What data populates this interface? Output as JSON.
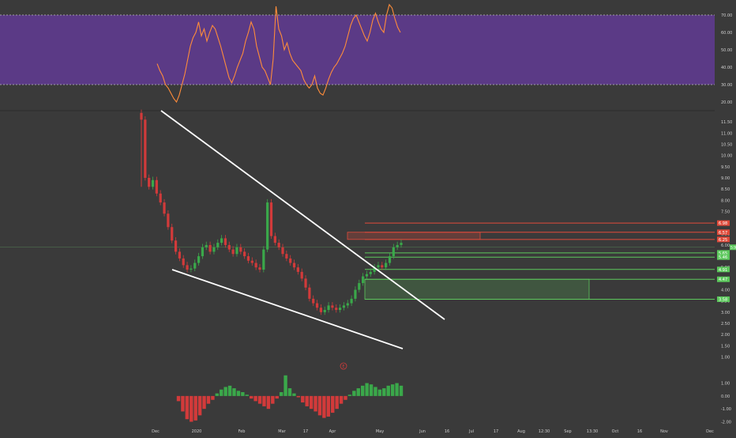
{
  "theme": {
    "background": "#3a3a3a",
    "rsi_band_fill": "#5b3a86",
    "rsi_line": "#ff8c3a",
    "up": "#3aa84a",
    "down": "#d23a3a",
    "trendline": "#ffffff",
    "support": "#5cc85c",
    "resistance": "#e04a3a",
    "axis_text": "#cfcfcf"
  },
  "chart_data": [
    {
      "type": "line",
      "panel": "rsi",
      "ylim": [
        15,
        78
      ],
      "y_ticks": [
        "70.00",
        "60.00",
        "50.00",
        "40.00",
        "30.00",
        "20.00"
      ],
      "band": [
        30,
        70
      ],
      "grid": false,
      "values": [
        42,
        38,
        35,
        30,
        28,
        25,
        22,
        20,
        24,
        30,
        36,
        44,
        52,
        57,
        60,
        66,
        58,
        62,
        55,
        60,
        64,
        62,
        57,
        52,
        46,
        40,
        34,
        31,
        35,
        40,
        44,
        48,
        55,
        60,
        66,
        62,
        52,
        46,
        40,
        38,
        34,
        30,
        45,
        75,
        62,
        58,
        50,
        54,
        48,
        44,
        42,
        40,
        38,
        33,
        30,
        28,
        30,
        35,
        28,
        25,
        24,
        28,
        33,
        37,
        40,
        42,
        45,
        48,
        52,
        58,
        64,
        68,
        70,
        66,
        62,
        58,
        55,
        60,
        67,
        71,
        66,
        62,
        60,
        70,
        76,
        74,
        68,
        63,
        60
      ]
    },
    {
      "type": "candlestick",
      "panel": "price",
      "ylim": [
        0.7,
        12.0
      ],
      "y_ticks": [
        "11.50",
        "11.00",
        "10.50",
        "10.00",
        "9.50",
        "9.00",
        "8.50",
        "8.00",
        "7.50",
        "7.00",
        "6.50",
        "6.00",
        "5.50",
        "5.00",
        "4.50",
        "4.00",
        "3.50",
        "3.00",
        "2.50",
        "2.00",
        "1.50",
        "1.00"
      ],
      "x_ticks": [
        "Dec",
        "2020",
        "Feb",
        "Mar",
        "17",
        "Apr",
        "May",
        "Jun",
        "16",
        "Jul",
        "17",
        "Aug",
        "12:30",
        "Sep",
        "13:30",
        "Oct",
        "16",
        "Nov",
        "Dec"
      ],
      "close": [
        11.6,
        9.0,
        8.6,
        8.9,
        8.3,
        7.9,
        7.4,
        6.8,
        6.2,
        5.7,
        5.4,
        5.1,
        4.9,
        4.95,
        5.2,
        5.5,
        5.9,
        6.0,
        5.7,
        5.9,
        6.1,
        6.3,
        6.0,
        5.8,
        5.6,
        5.9,
        5.7,
        5.5,
        5.3,
        5.2,
        5.0,
        4.9,
        5.8,
        7.9,
        6.4,
        6.1,
        5.9,
        5.6,
        5.4,
        5.2,
        5.0,
        4.8,
        4.5,
        4.1,
        3.6,
        3.4,
        3.2,
        3.0,
        3.1,
        3.3,
        3.2,
        3.1,
        3.2,
        3.3,
        3.4,
        3.6,
        4.0,
        4.3,
        4.6,
        4.7,
        4.8,
        5.0,
        5.1,
        5.0,
        5.2,
        5.5,
        5.9,
        6.0,
        6.1
      ]
    },
    {
      "type": "bar",
      "panel": "momentum",
      "ylim": [
        -2.4,
        2.2
      ],
      "y_ticks": [
        "1.00",
        "0.00",
        "-1.00",
        "-2.00"
      ],
      "values": [
        -0.4,
        -1.2,
        -1.8,
        -2.0,
        -1.9,
        -1.5,
        -1.0,
        -0.6,
        -0.3,
        0.2,
        0.5,
        0.7,
        0.8,
        0.6,
        0.4,
        0.3,
        0.1,
        -0.2,
        -0.4,
        -0.6,
        -0.8,
        -1.0,
        -0.6,
        -0.2,
        0.3,
        1.6,
        0.6,
        0.2,
        -0.1,
        -0.5,
        -0.8,
        -1.0,
        -1.2,
        -1.5,
        -1.7,
        -1.6,
        -1.3,
        -1.0,
        -0.6,
        -0.3,
        0.1,
        0.4,
        0.6,
        0.8,
        1.0,
        0.9,
        0.7,
        0.5,
        0.6,
        0.8,
        0.9,
        1.0,
        0.8
      ]
    }
  ],
  "levels": {
    "price_tags": [
      "6.98",
      "6.57",
      "6.25",
      "5.65",
      "5.46",
      "4.91",
      "4.47",
      "3.58"
    ],
    "last_price_tag": "5.9"
  },
  "marker": {
    "label": "E"
  }
}
